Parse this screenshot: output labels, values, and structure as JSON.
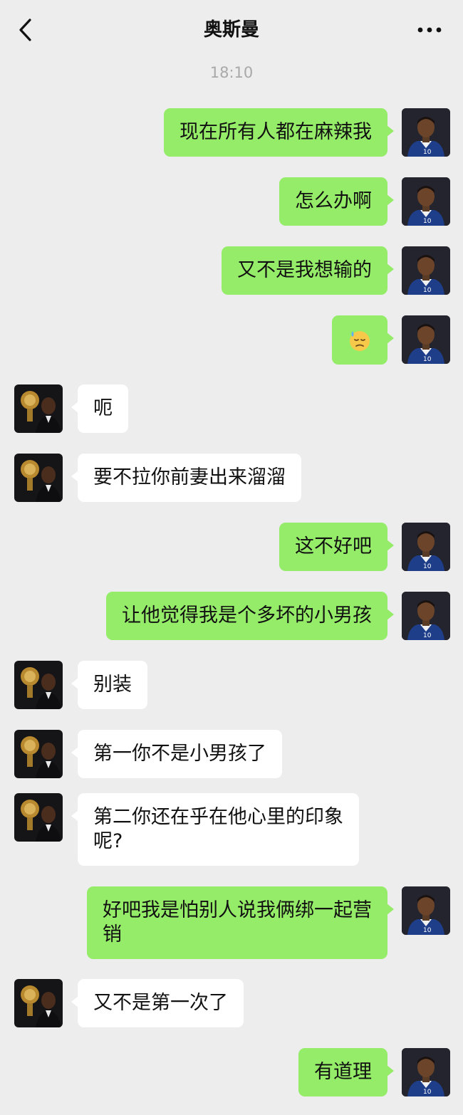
{
  "header": {
    "title": "奥斯曼",
    "back_icon": "chevron-left-icon",
    "more_icon": "more-dots-icon"
  },
  "timestamp": "18:10",
  "colors": {
    "background": "#ededed",
    "sent_bubble": "#95ec69",
    "received_bubble": "#ffffff",
    "timestamp": "#a9a9a9"
  },
  "messages": [
    {
      "sender": "me",
      "text": "现在所有人都在麻辣我"
    },
    {
      "sender": "me",
      "text": "怎么办啊"
    },
    {
      "sender": "me",
      "text": "又不是我想输的"
    },
    {
      "sender": "me",
      "emoji": "downcast-face-with-sweat-icon"
    },
    {
      "sender": "other",
      "text": "呃"
    },
    {
      "sender": "other",
      "text": "要不拉你前妻出来溜溜"
    },
    {
      "sender": "me",
      "text": "这不好吧"
    },
    {
      "sender": "me",
      "text": "让他觉得我是个多坏的小男孩"
    },
    {
      "sender": "other",
      "text": "别装"
    },
    {
      "sender": "other",
      "text": "第一你不是小男孩了"
    },
    {
      "sender": "other",
      "text": "第二你还在乎在他心里的印象\n呢?"
    },
    {
      "sender": "me",
      "text": "好吧我是怕别人说我俩绑一起营\n销"
    },
    {
      "sender": "other",
      "text": "又不是第一次了"
    },
    {
      "sender": "me",
      "text": "有道理"
    }
  ]
}
